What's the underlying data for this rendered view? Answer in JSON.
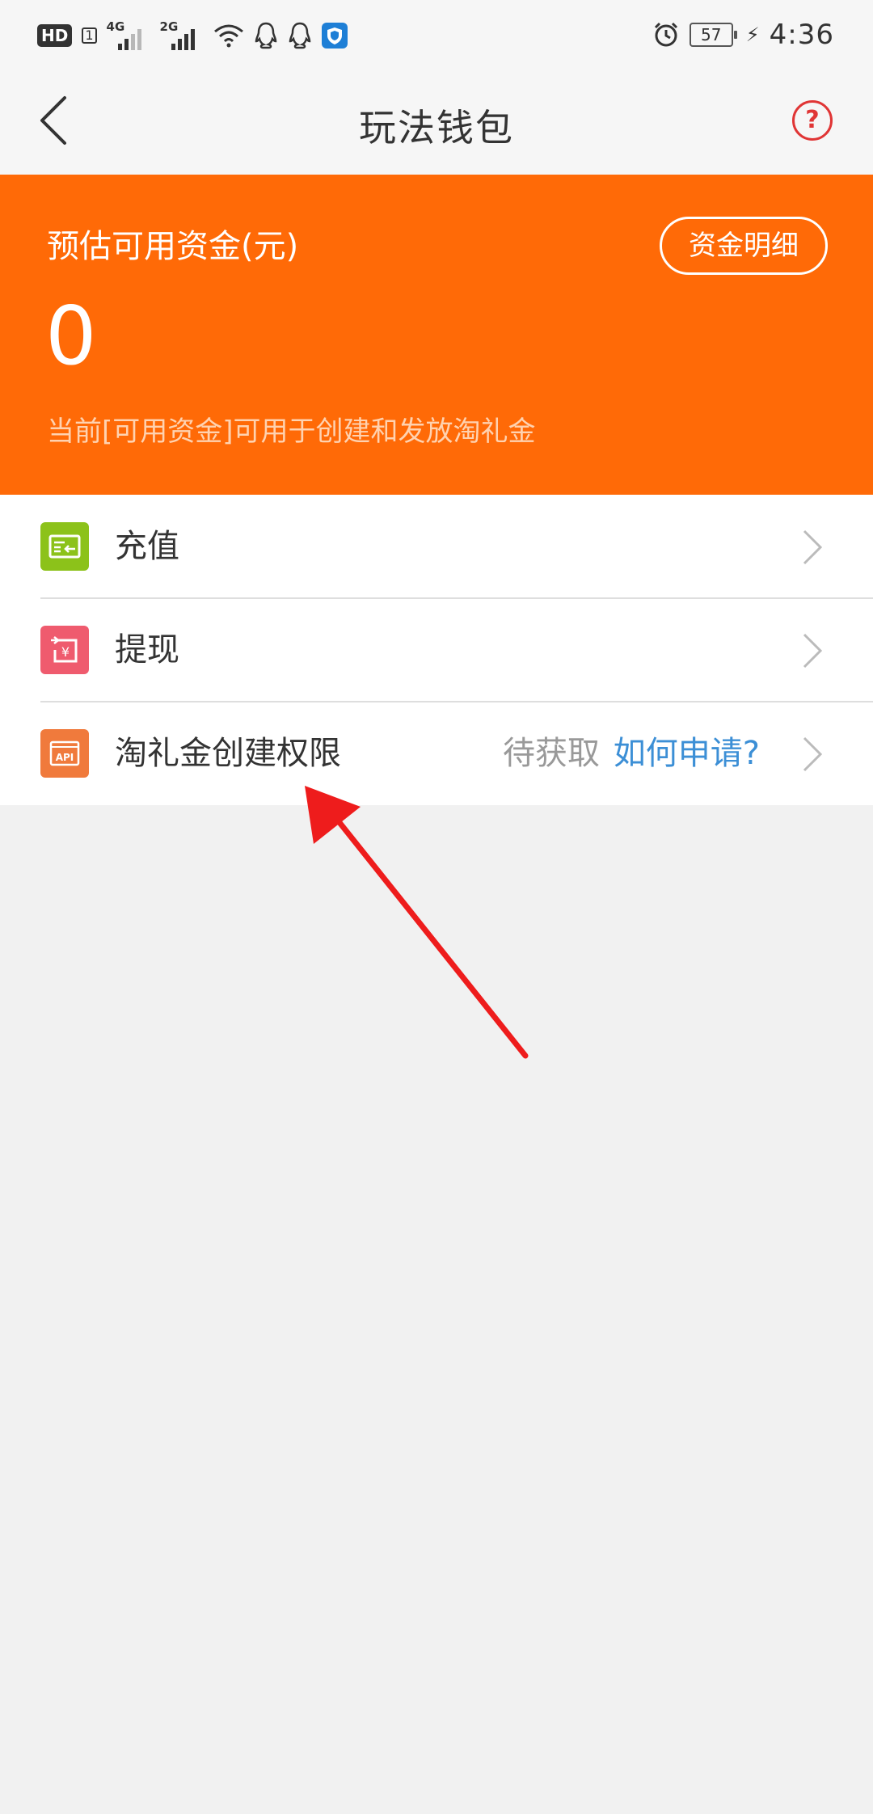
{
  "status_bar": {
    "hd": "HD",
    "sim": "1",
    "net1": "4G",
    "net2": "2G",
    "battery": "57",
    "time": "4:36"
  },
  "nav": {
    "title": "玩法钱包"
  },
  "balance": {
    "label": "预估可用资金(元)",
    "value": "0",
    "detail_button": "资金明细",
    "note": "当前[可用资金]可用于创建和发放淘礼金"
  },
  "menu": [
    {
      "label": "充值",
      "icon": "recharge-card-icon",
      "color": "#8cc21a"
    },
    {
      "label": "提现",
      "icon": "withdraw-yen-icon",
      "color": "#ef5b6e"
    },
    {
      "label": "淘礼金创建权限",
      "icon": "api-icon",
      "color": "#f07a3c",
      "status": "待获取",
      "link": "如何申请?"
    }
  ],
  "colors": {
    "accent": "#ff6a07",
    "link": "#3c8fd6",
    "help": "#e03535"
  }
}
